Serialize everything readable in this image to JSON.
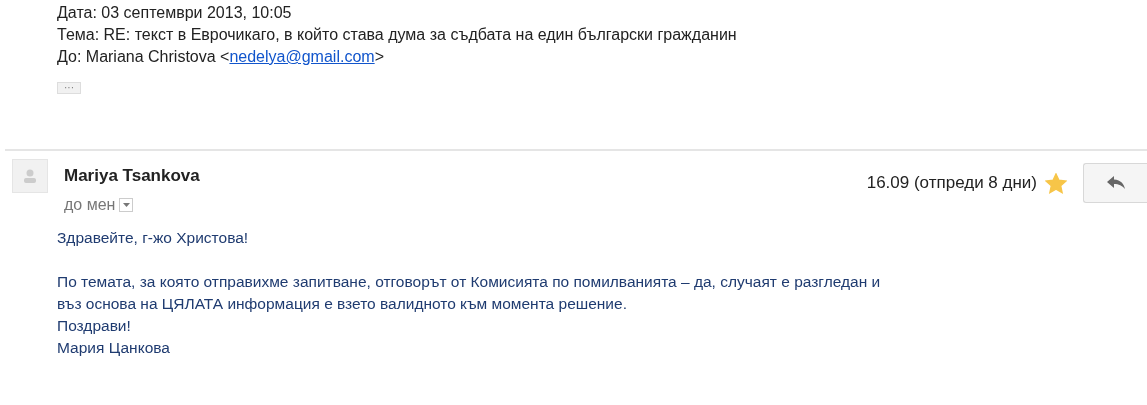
{
  "quoted_header": {
    "date": "Дата: 03 септември 2013, 10:05",
    "subject": "Тема: RE: текст в Еврочикаго, в който става дума за съдбата на един български гражданин",
    "to_prefix": "До: Mariana Christova <",
    "to_email": "nedelya@gmail.com",
    "to_suffix": ">",
    "more": "···"
  },
  "message": {
    "sender": "Mariya Tsankova",
    "recipient": "до мен",
    "date": "16.09 (отпреди 8 дни)",
    "starred": true,
    "body": [
      [
        "Здравейте, г-жо Христова!"
      ],
      [
        "По темата, за която отправихме запитване, отговорът от Комисията по помилванията – да, случаят е разгледан и",
        "въз основа на ЦЯЛАТА информация е взето валидното към момента решение.",
        "Поздрави!",
        "Мария Цанкова"
      ]
    ]
  }
}
